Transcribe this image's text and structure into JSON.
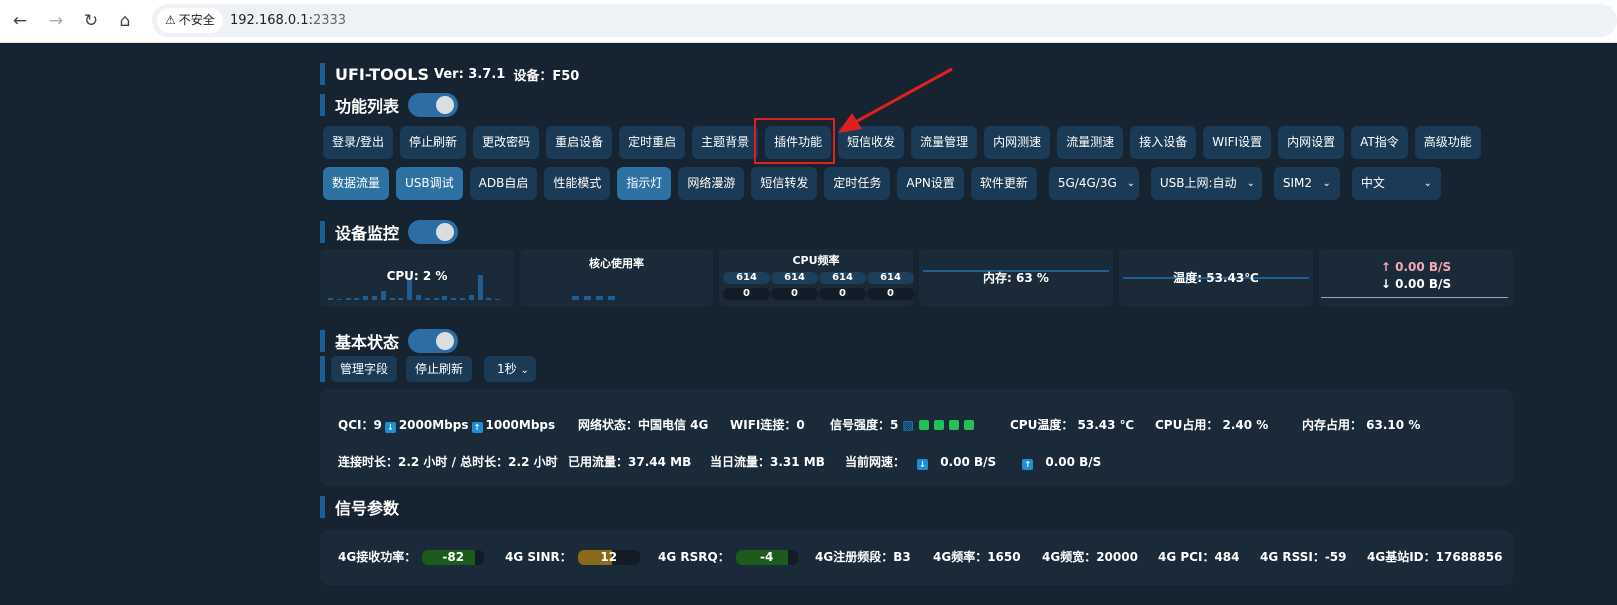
{
  "browser": {
    "security_label": "不安全",
    "host": "192.168.0.1:",
    "port": "2333"
  },
  "header": {
    "app_name": "UFI-TOOLS",
    "version_label": "Ver: 3.7.1",
    "device_label": "设备：F50"
  },
  "feature_section": {
    "title": "功能列表",
    "toggle_on": true
  },
  "row1_buttons": [
    "登录/登出",
    "停止刷新",
    "更改密码",
    "重启设备",
    "定时重启",
    "主题背景",
    "插件功能",
    "短信收发",
    "流量管理",
    "内网测速",
    "流量测速",
    "接入设备",
    "WIFI设置",
    "内网设置",
    "AT指令",
    "高级功能"
  ],
  "row2_buttons": [
    {
      "label": "数据流量",
      "active": true
    },
    {
      "label": "USB调试",
      "active": true
    },
    {
      "label": "ADB自启",
      "active": false
    },
    {
      "label": "性能模式",
      "active": false
    },
    {
      "label": "指示灯",
      "active": true
    },
    {
      "label": "网络漫游",
      "active": false
    },
    {
      "label": "短信转发",
      "active": false
    },
    {
      "label": "定时任务",
      "active": false
    },
    {
      "label": "APN设置",
      "active": false
    },
    {
      "label": "软件更新",
      "active": false
    }
  ],
  "row2_selects": [
    "5G/4G/3G",
    "USB上网:自动",
    "SIM2",
    "中文"
  ],
  "highlighted_button": "插件功能",
  "monitor": {
    "title": "设备监控",
    "cpu_label": "CPU: 2 %",
    "cpu_history": [
      0.1,
      0.05,
      0.1,
      0.1,
      0.15,
      0.15,
      0.35,
      0.1,
      0.1,
      0.8,
      0.2,
      0.1,
      0.1,
      0.15,
      0.1,
      0.1,
      0.2,
      1.0,
      0.1,
      0.05
    ],
    "core_usage_title": "核心使用率",
    "core_usage": [
      0.15,
      0.15,
      0.15,
      0.15
    ],
    "cpu_freq_title": "CPU频率",
    "cpu_freq": [
      "614",
      "614",
      "614",
      "614"
    ],
    "cpu_freq_util": [
      "0",
      "0",
      "0",
      "0"
    ],
    "memory_label": "内存: 63 %",
    "temperature_label": "温度: 53.43℃",
    "upload_speed": "↑ 0.00 B/S",
    "download_speed": "↓ 0.00 B/S"
  },
  "basic_status": {
    "title": "基本状态",
    "manage_fields_btn": "管理字段",
    "stop_refresh_btn": "停止刷新",
    "interval": "1秒",
    "qci_label": "QCI：9",
    "dl_rate": "2000Mbps",
    "ul_rate": "1000Mbps",
    "network_status": "网络状态：中国电信 4G",
    "wifi_conn": "WIFI连接：0",
    "signal_strength": "信号强度：5",
    "signal_bars": 4,
    "cpu_temp": "CPU温度：  53.43 ℃",
    "cpu_usage": "CPU占用：  2.40 %",
    "mem_usage": "内存占用：  63.10 %",
    "conn_duration": "连接时长：2.2 小时 / 总时长：2.2 小时",
    "used_traffic": "已用流量：37.44 MB",
    "today_traffic": "当日流量：3.31 MB",
    "current_speed_label": "当前网速：",
    "current_dl": "0.00 B/S",
    "current_ul": "0.00 B/S"
  },
  "signal_params": {
    "title": "信号参数",
    "rsrp_label": "4G接收功率：",
    "rsrp_value": "-82",
    "rsrp_level": 0.85,
    "rsrp_color": "#1d5a1d",
    "sinr_label": "4G SINR：",
    "sinr_value": "12",
    "sinr_level": 0.55,
    "sinr_color": "#8a6a1a",
    "rsrq_label": "4G RSRQ：",
    "rsrq_value": "-4",
    "rsrq_level": 0.85,
    "rsrq_color": "#1d5a1d",
    "band": "4G注册频段：B3",
    "freq": "4G频率：1650",
    "bandwidth": "4G频宽：20000",
    "pci": "4G PCI：484",
    "rssi": "4G RSSI：-59",
    "cell_id": "4G基站ID：17688856"
  }
}
